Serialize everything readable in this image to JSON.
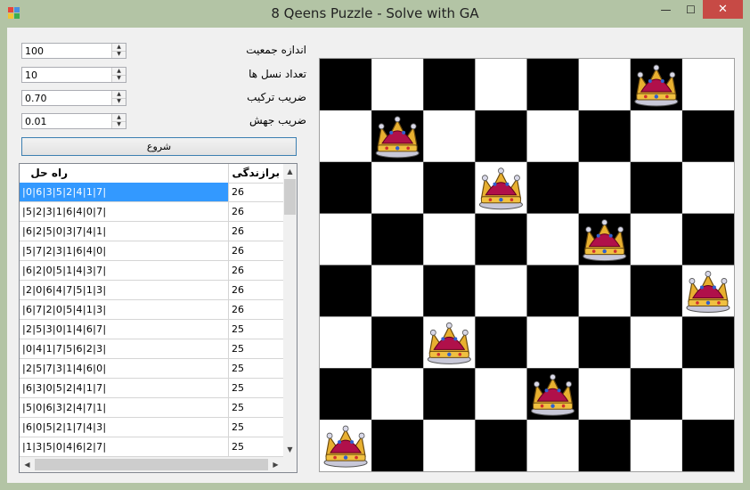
{
  "window": {
    "title": "8 Qeens Puzzle - Solve with GA",
    "minimize_glyph": "—",
    "maximize_glyph": "☐",
    "close_glyph": "✕"
  },
  "params": [
    {
      "label": "اندازه جمعیت",
      "value": "100"
    },
    {
      "label": "تعداد نسل ها",
      "value": "10"
    },
    {
      "label": "ضریب ترکیب",
      "value": "0.70"
    },
    {
      "label": "ضریب جهش",
      "value": "0.01"
    }
  ],
  "start_button": "شروع",
  "grid": {
    "columns": {
      "solution": "راه حل",
      "fitness": "برازندگی"
    },
    "rows": [
      {
        "solution": "|0|6|3|5|2|4|1|7|",
        "fitness": "26"
      },
      {
        "solution": "|5|2|3|1|6|4|0|7|",
        "fitness": "26"
      },
      {
        "solution": "|6|2|5|0|3|7|4|1|",
        "fitness": "26"
      },
      {
        "solution": "|5|7|2|3|1|6|4|0|",
        "fitness": "26"
      },
      {
        "solution": "|6|2|0|5|1|4|3|7|",
        "fitness": "26"
      },
      {
        "solution": "|2|0|6|4|7|5|1|3|",
        "fitness": "26"
      },
      {
        "solution": "|6|7|2|0|5|4|1|3|",
        "fitness": "26"
      },
      {
        "solution": "|2|5|3|0|1|4|6|7|",
        "fitness": "25"
      },
      {
        "solution": "|0|4|1|7|5|6|2|3|",
        "fitness": "25"
      },
      {
        "solution": "|2|5|7|3|1|4|6|0|",
        "fitness": "25"
      },
      {
        "solution": "|6|3|0|5|2|4|1|7|",
        "fitness": "25"
      },
      {
        "solution": "|5|0|6|3|2|4|7|1|",
        "fitness": "25"
      },
      {
        "solution": "|6|0|5|2|1|7|4|3|",
        "fitness": "25"
      },
      {
        "solution": "|1|3|5|0|4|6|2|7|",
        "fitness": "25"
      }
    ],
    "selected_row": 0
  },
  "board": {
    "size": 8,
    "queens_row_per_col": [
      7,
      1,
      5,
      2,
      6,
      3,
      0,
      4
    ],
    "dark_color": "#000000",
    "light_color": "#ffffff"
  },
  "icons": {
    "app": "app-icon",
    "queen": "queen-crown-icon",
    "spin_up": "▲",
    "spin_down": "▼",
    "scroll_up": "▲",
    "scroll_down": "▼",
    "scroll_left": "◀",
    "scroll_right": "▶"
  }
}
